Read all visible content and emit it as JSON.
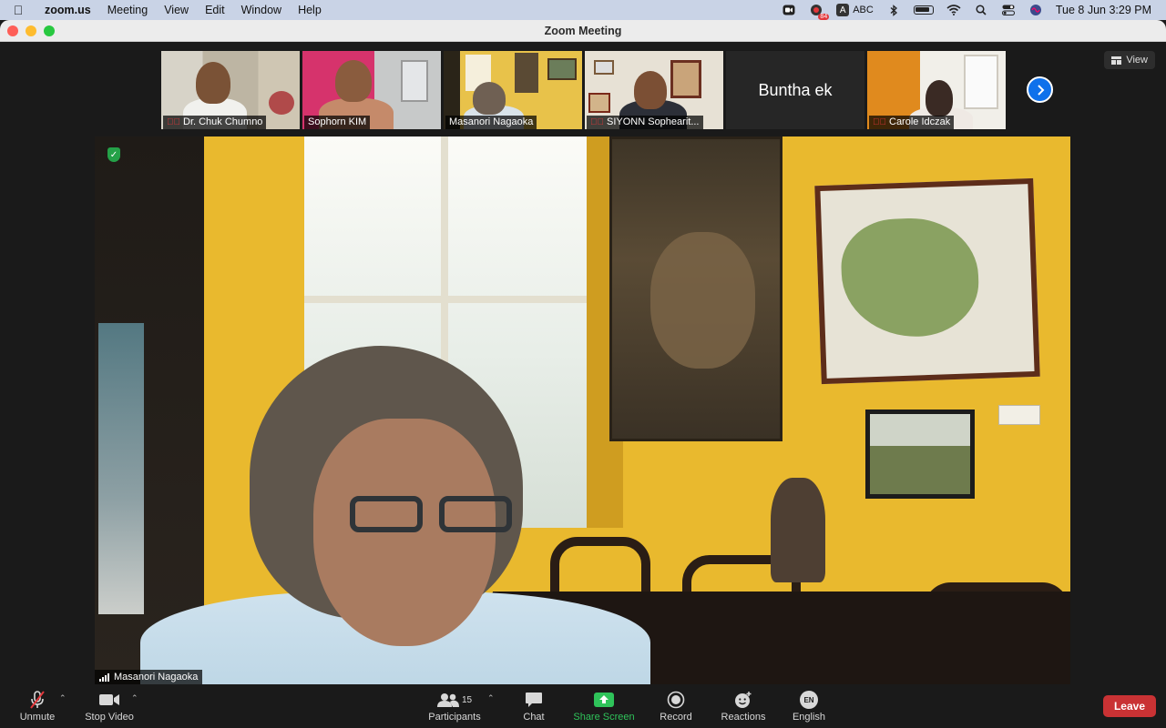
{
  "menubar": {
    "app": "zoom.us",
    "items": [
      "Meeting",
      "View",
      "Edit",
      "Window",
      "Help"
    ],
    "input_source": "ABC",
    "notification_count": "84",
    "clock": "Tue 8 Jun  3:29 PM"
  },
  "window": {
    "title": "Zoom Meeting"
  },
  "view_button": {
    "label": "View"
  },
  "thumbnails": [
    {
      "name": "Dr. Chuk Chumno",
      "muted": true
    },
    {
      "name": "Sophorn KIM",
      "muted": false
    },
    {
      "name": "Masanori Nagaoka",
      "muted": false
    },
    {
      "name": "SIYONN Sophearit...",
      "muted": true
    },
    {
      "name": "Buntha ek",
      "muted": false
    },
    {
      "name": "Carole Idczak",
      "muted": true
    }
  ],
  "main_video": {
    "speaker": "Masanori Nagaoka"
  },
  "toolbar": {
    "unmute": "Unmute",
    "stop_video": "Stop Video",
    "participants": "Participants",
    "participants_count": "15",
    "chat": "Chat",
    "share_screen": "Share Screen",
    "record": "Record",
    "reactions": "Reactions",
    "language": "English",
    "language_code": "EN",
    "leave": "Leave"
  },
  "colors": {
    "accent_blue": "#0e71eb",
    "leave_red": "#c93234",
    "share_green": "#2fc35a",
    "wall_yellow": "#e9b92e"
  }
}
